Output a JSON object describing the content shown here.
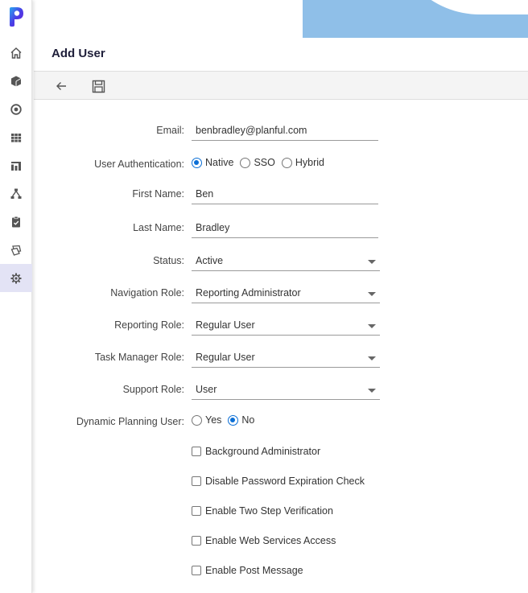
{
  "app": {
    "brand_color": "#5b2be0",
    "accent_color": "#0b6fd6"
  },
  "sidebar": {
    "items": [
      {
        "name": "home",
        "icon": "home-icon"
      },
      {
        "name": "cube",
        "icon": "cube-icon"
      },
      {
        "name": "target",
        "icon": "target-icon"
      },
      {
        "name": "grid",
        "icon": "grid-icon"
      },
      {
        "name": "reports",
        "icon": "bar-chart-icon"
      },
      {
        "name": "hierarchy",
        "icon": "hierarchy-icon"
      },
      {
        "name": "tasks",
        "icon": "clipboard-check-icon"
      },
      {
        "name": "layers",
        "icon": "layers-icon"
      },
      {
        "name": "settings",
        "icon": "gear-icon",
        "active": true
      }
    ]
  },
  "page": {
    "title": "Add User"
  },
  "toolbar": {
    "back_icon": "arrow-left-icon",
    "save_icon": "save-icon"
  },
  "form": {
    "email": {
      "label": "Email:",
      "value": "benbradley@planful.com"
    },
    "auth": {
      "label": "User Authentication:",
      "options": [
        "Native",
        "SSO",
        "Hybrid"
      ],
      "selected": "Native"
    },
    "first_name": {
      "label": "First Name:",
      "value": "Ben"
    },
    "last_name": {
      "label": "Last Name:",
      "value": "Bradley"
    },
    "status": {
      "label": "Status:",
      "value": "Active"
    },
    "navigation_role": {
      "label": "Navigation Role:",
      "value": "Reporting Administrator"
    },
    "reporting_role": {
      "label": "Reporting Role:",
      "value": "Regular User"
    },
    "task_manager_role": {
      "label": "Task Manager Role:",
      "value": "Regular User"
    },
    "support_role": {
      "label": "Support Role:",
      "value": "User"
    },
    "dynamic_planning": {
      "label": "Dynamic Planning User:",
      "options": [
        "Yes",
        "No"
      ],
      "selected": "No"
    },
    "checkboxes": [
      {
        "label": "Background Administrator",
        "checked": false
      },
      {
        "label": "Disable Password Expiration Check",
        "checked": false
      },
      {
        "label": "Enable Two Step Verification",
        "checked": false
      },
      {
        "label": "Enable Web Services Access",
        "checked": false
      },
      {
        "label": "Enable Post Message",
        "checked": false
      }
    ]
  }
}
